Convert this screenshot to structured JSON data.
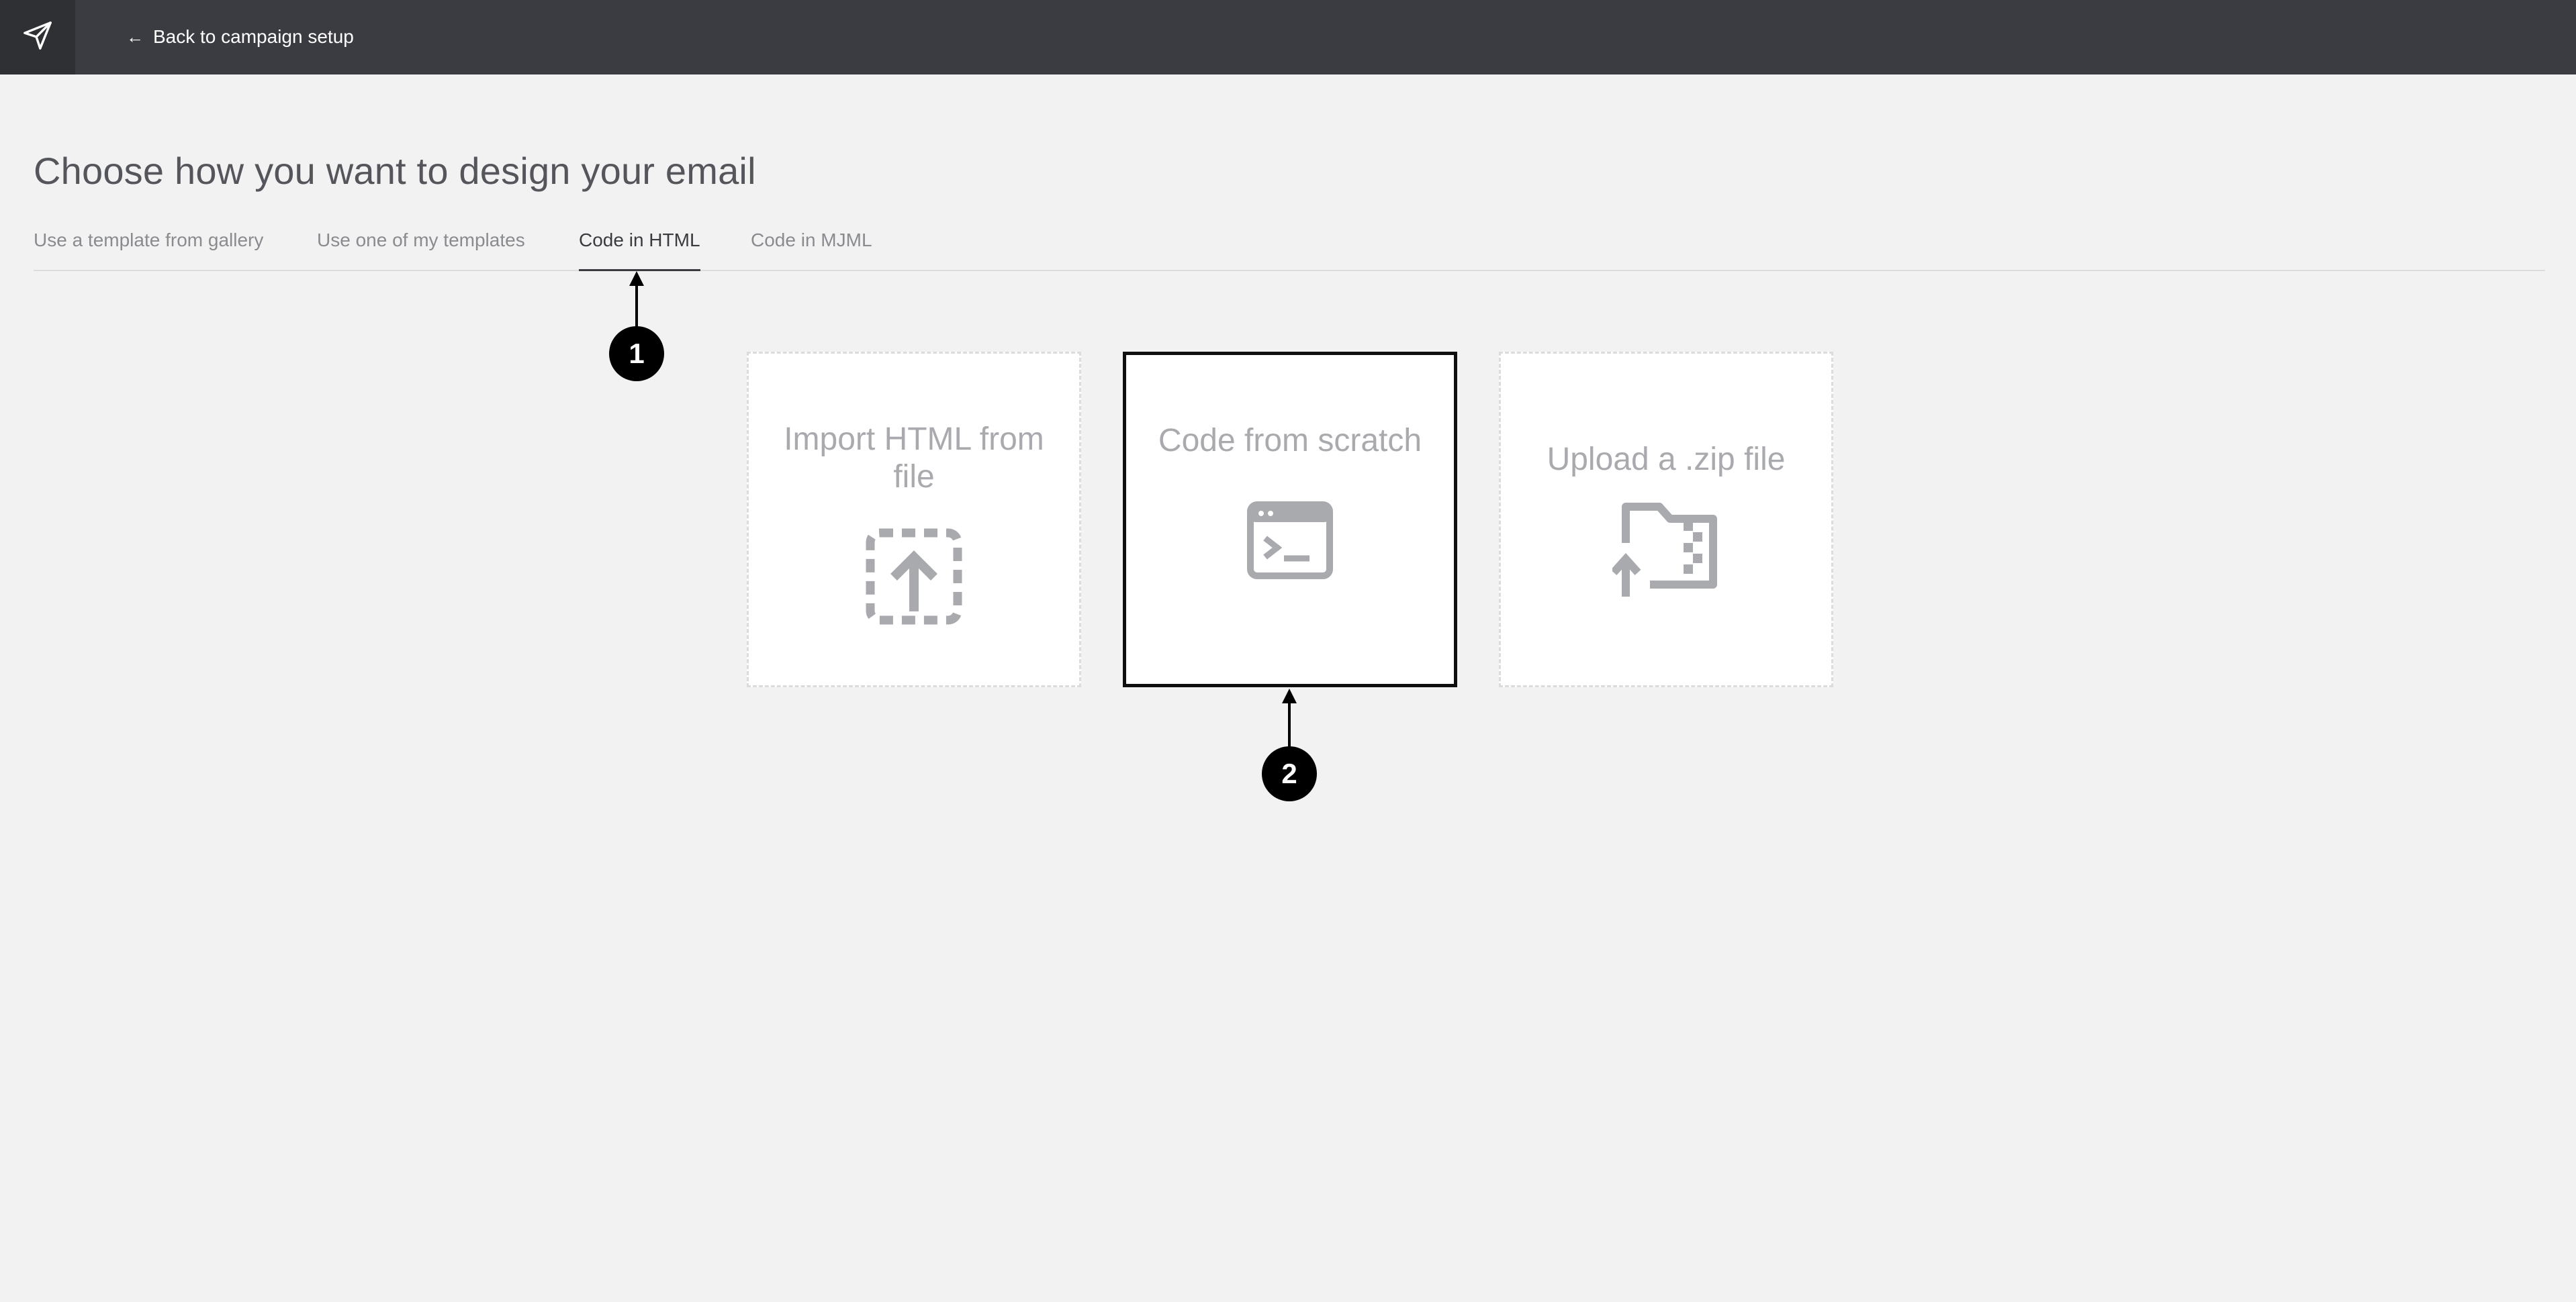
{
  "topbar": {
    "logo_icon": "paper-plane-icon",
    "back_arrow": "←",
    "back_label": "Back to campaign setup"
  },
  "page": {
    "title": "Choose how you want to design your email"
  },
  "tabs": [
    {
      "label": "Use a template from gallery",
      "active": false
    },
    {
      "label": "Use one of my templates",
      "active": false
    },
    {
      "label": "Code in HTML",
      "active": true
    },
    {
      "label": "Code in MJML",
      "active": false
    }
  ],
  "cards": [
    {
      "title": "Import HTML from file",
      "icon": "upload-dashed-box-icon",
      "selected": false
    },
    {
      "title": "Code from scratch",
      "icon": "code-window-icon",
      "selected": true
    },
    {
      "title": "Upload a .zip file",
      "icon": "zip-folder-upload-icon",
      "selected": false
    }
  ],
  "annotations": [
    {
      "number": "1",
      "target": "Code in HTML tab"
    },
    {
      "number": "2",
      "target": "Code from scratch card"
    }
  ],
  "colors": {
    "topbar": "#3b3c41",
    "background": "#f2f2f2",
    "card_text": "#a9aaae",
    "selected_border": "#0f0f0f"
  }
}
